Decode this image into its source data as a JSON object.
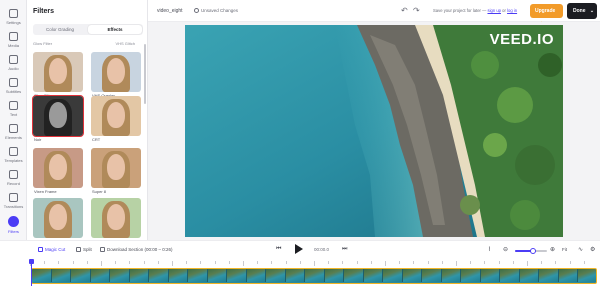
{
  "rail": {
    "items": [
      {
        "label": "Settings",
        "icon": "gear-icon"
      },
      {
        "label": "Media",
        "icon": "plus-icon"
      },
      {
        "label": "Audio",
        "icon": "music-icon"
      },
      {
        "label": "Subtitles",
        "icon": "subtitles-icon"
      },
      {
        "label": "Text",
        "icon": "text-icon"
      },
      {
        "label": "Elements",
        "icon": "shapes-icon"
      },
      {
        "label": "Templates",
        "icon": "template-icon"
      },
      {
        "label": "Record",
        "icon": "record-icon"
      },
      {
        "label": "Transitions",
        "icon": "transition-icon"
      },
      {
        "label": "Filters",
        "icon": "filter-icon"
      }
    ],
    "active": "Filters",
    "help": "?"
  },
  "panel": {
    "title": "Filters",
    "tabs": [
      "Color Grading",
      "Effects"
    ],
    "active_tab": "Effects",
    "top_labels": [
      "Glow Filter",
      "VHS Glitch"
    ],
    "filters": [
      {
        "label": "Glow Filter",
        "tint": "#d9c9b8"
      },
      {
        "label": "VHS Overlay",
        "tint": "#c8d4e0"
      },
      {
        "label": "Noir",
        "tint": "#3a3a3a"
      },
      {
        "label": "CRT",
        "tint": "#e3c7a5"
      },
      {
        "label": "Vixen Frame",
        "tint": "#c79a86"
      },
      {
        "label": "Super 8",
        "tint": "#caa17a"
      },
      {
        "label": "Glitch",
        "tint": "#a9c6c0"
      },
      {
        "label": "Retro Frame",
        "tint": "#b7d2a5"
      }
    ],
    "selected_filter": "Noir"
  },
  "topbar": {
    "project_name": "video_eight",
    "unsaved": "Unsaved Changes",
    "save_note": "Save your project for later —",
    "sign_up": "sign up",
    "or": "or",
    "log_in": "log in",
    "upgrade": "Upgrade",
    "done": "Done"
  },
  "canvas": {
    "watermark": "VEED.IO"
  },
  "toolbar": {
    "magic_cut": "Magic Cut",
    "split": "Split",
    "download_section": "Download Section (00:00 – 0:26)",
    "timecode": "00:00.0",
    "zoom_level": 0.55,
    "fit": "Fit"
  },
  "timeline": {
    "frames": 29
  },
  "colors": {
    "accent": "#4b3cf5",
    "upgrade": "#f29b29",
    "done": "#1c1d22",
    "track_border": "#f0b527",
    "selected_outline": "#e0323a"
  }
}
